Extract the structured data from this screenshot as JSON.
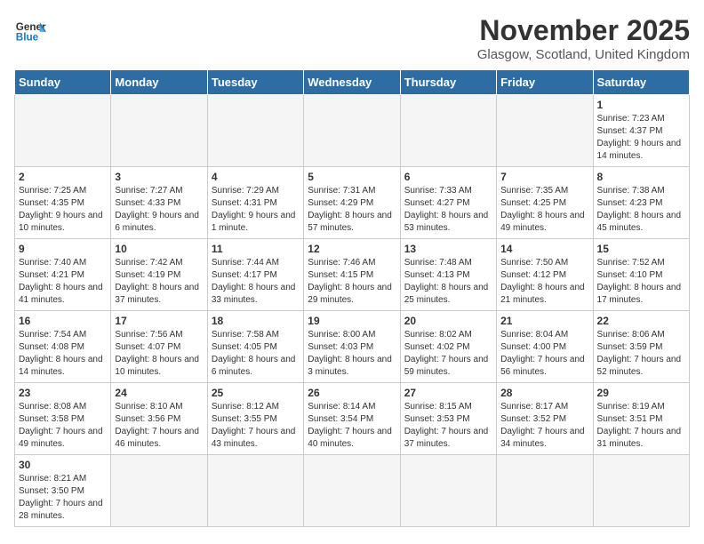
{
  "logo": {
    "general": "General",
    "blue": "Blue"
  },
  "header": {
    "month_year": "November 2025",
    "location": "Glasgow, Scotland, United Kingdom"
  },
  "weekdays": [
    "Sunday",
    "Monday",
    "Tuesday",
    "Wednesday",
    "Thursday",
    "Friday",
    "Saturday"
  ],
  "weeks": [
    [
      {
        "day": "",
        "info": "",
        "empty": true
      },
      {
        "day": "",
        "info": "",
        "empty": true
      },
      {
        "day": "",
        "info": "",
        "empty": true
      },
      {
        "day": "",
        "info": "",
        "empty": true
      },
      {
        "day": "",
        "info": "",
        "empty": true
      },
      {
        "day": "",
        "info": "",
        "empty": true
      },
      {
        "day": "1",
        "info": "Sunrise: 7:23 AM\nSunset: 4:37 PM\nDaylight: 9 hours and 14 minutes."
      }
    ],
    [
      {
        "day": "2",
        "info": "Sunrise: 7:25 AM\nSunset: 4:35 PM\nDaylight: 9 hours and 10 minutes."
      },
      {
        "day": "3",
        "info": "Sunrise: 7:27 AM\nSunset: 4:33 PM\nDaylight: 9 hours and 6 minutes."
      },
      {
        "day": "4",
        "info": "Sunrise: 7:29 AM\nSunset: 4:31 PM\nDaylight: 9 hours and 1 minute."
      },
      {
        "day": "5",
        "info": "Sunrise: 7:31 AM\nSunset: 4:29 PM\nDaylight: 8 hours and 57 minutes."
      },
      {
        "day": "6",
        "info": "Sunrise: 7:33 AM\nSunset: 4:27 PM\nDaylight: 8 hours and 53 minutes."
      },
      {
        "day": "7",
        "info": "Sunrise: 7:35 AM\nSunset: 4:25 PM\nDaylight: 8 hours and 49 minutes."
      },
      {
        "day": "8",
        "info": "Sunrise: 7:38 AM\nSunset: 4:23 PM\nDaylight: 8 hours and 45 minutes."
      }
    ],
    [
      {
        "day": "9",
        "info": "Sunrise: 7:40 AM\nSunset: 4:21 PM\nDaylight: 8 hours and 41 minutes."
      },
      {
        "day": "10",
        "info": "Sunrise: 7:42 AM\nSunset: 4:19 PM\nDaylight: 8 hours and 37 minutes."
      },
      {
        "day": "11",
        "info": "Sunrise: 7:44 AM\nSunset: 4:17 PM\nDaylight: 8 hours and 33 minutes."
      },
      {
        "day": "12",
        "info": "Sunrise: 7:46 AM\nSunset: 4:15 PM\nDaylight: 8 hours and 29 minutes."
      },
      {
        "day": "13",
        "info": "Sunrise: 7:48 AM\nSunset: 4:13 PM\nDaylight: 8 hours and 25 minutes."
      },
      {
        "day": "14",
        "info": "Sunrise: 7:50 AM\nSunset: 4:12 PM\nDaylight: 8 hours and 21 minutes."
      },
      {
        "day": "15",
        "info": "Sunrise: 7:52 AM\nSunset: 4:10 PM\nDaylight: 8 hours and 17 minutes."
      }
    ],
    [
      {
        "day": "16",
        "info": "Sunrise: 7:54 AM\nSunset: 4:08 PM\nDaylight: 8 hours and 14 minutes."
      },
      {
        "day": "17",
        "info": "Sunrise: 7:56 AM\nSunset: 4:07 PM\nDaylight: 8 hours and 10 minutes."
      },
      {
        "day": "18",
        "info": "Sunrise: 7:58 AM\nSunset: 4:05 PM\nDaylight: 8 hours and 6 minutes."
      },
      {
        "day": "19",
        "info": "Sunrise: 8:00 AM\nSunset: 4:03 PM\nDaylight: 8 hours and 3 minutes."
      },
      {
        "day": "20",
        "info": "Sunrise: 8:02 AM\nSunset: 4:02 PM\nDaylight: 7 hours and 59 minutes."
      },
      {
        "day": "21",
        "info": "Sunrise: 8:04 AM\nSunset: 4:00 PM\nDaylight: 7 hours and 56 minutes."
      },
      {
        "day": "22",
        "info": "Sunrise: 8:06 AM\nSunset: 3:59 PM\nDaylight: 7 hours and 52 minutes."
      }
    ],
    [
      {
        "day": "23",
        "info": "Sunrise: 8:08 AM\nSunset: 3:58 PM\nDaylight: 7 hours and 49 minutes."
      },
      {
        "day": "24",
        "info": "Sunrise: 8:10 AM\nSunset: 3:56 PM\nDaylight: 7 hours and 46 minutes."
      },
      {
        "day": "25",
        "info": "Sunrise: 8:12 AM\nSunset: 3:55 PM\nDaylight: 7 hours and 43 minutes."
      },
      {
        "day": "26",
        "info": "Sunrise: 8:14 AM\nSunset: 3:54 PM\nDaylight: 7 hours and 40 minutes."
      },
      {
        "day": "27",
        "info": "Sunrise: 8:15 AM\nSunset: 3:53 PM\nDaylight: 7 hours and 37 minutes."
      },
      {
        "day": "28",
        "info": "Sunrise: 8:17 AM\nSunset: 3:52 PM\nDaylight: 7 hours and 34 minutes."
      },
      {
        "day": "29",
        "info": "Sunrise: 8:19 AM\nSunset: 3:51 PM\nDaylight: 7 hours and 31 minutes."
      }
    ],
    [
      {
        "day": "30",
        "info": "Sunrise: 8:21 AM\nSunset: 3:50 PM\nDaylight: 7 hours and 28 minutes."
      },
      {
        "day": "",
        "info": "",
        "empty": true
      },
      {
        "day": "",
        "info": "",
        "empty": true
      },
      {
        "day": "",
        "info": "",
        "empty": true
      },
      {
        "day": "",
        "info": "",
        "empty": true
      },
      {
        "day": "",
        "info": "",
        "empty": true
      },
      {
        "day": "",
        "info": "",
        "empty": true
      }
    ]
  ]
}
